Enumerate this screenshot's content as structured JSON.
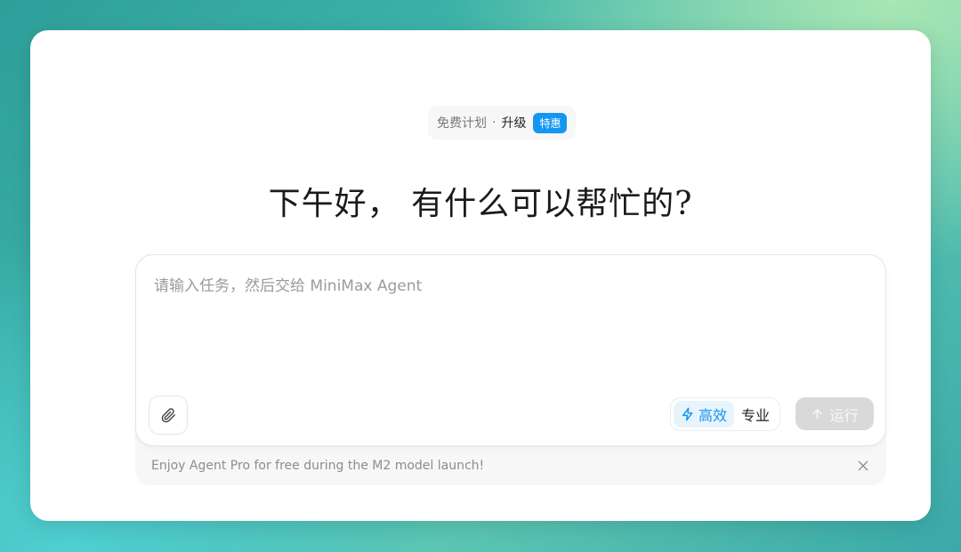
{
  "plan": {
    "free_label": "免费计划",
    "separator": "·",
    "upgrade_label": "升级",
    "badge_label": "特惠"
  },
  "greeting": "下午好， 有什么可以帮忙的?",
  "input": {
    "placeholder": "请输入任务，然后交给 MiniMax Agent",
    "value": ""
  },
  "modes": {
    "active_label": "高效",
    "inactive_label": "专业"
  },
  "run_label": "运行",
  "promo": {
    "text": "Enjoy Agent Pro for free during the M2 model launch!"
  },
  "icons": {
    "attach": "paperclip-icon",
    "mode": "lightning-icon",
    "run": "arrow-up-icon",
    "close": "close-icon"
  },
  "colors": {
    "accent": "#1596f0",
    "run_disabled": "#d9d9d9"
  }
}
